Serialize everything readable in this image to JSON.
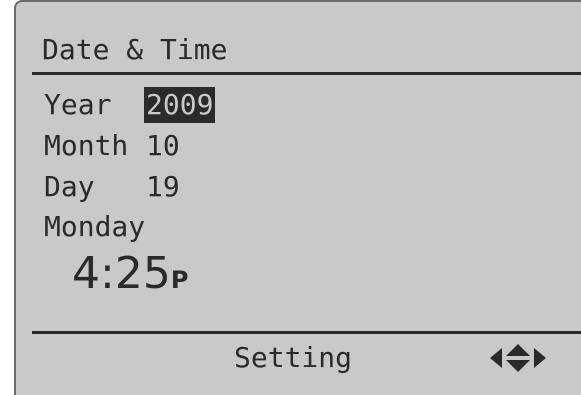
{
  "screen": {
    "title": "Date & Time",
    "fields": {
      "year": {
        "label": "Year",
        "value": "2009"
      },
      "month": {
        "label": "Month",
        "value": "10"
      },
      "day": {
        "label": "Day",
        "value": "19"
      }
    },
    "weekday": "Monday",
    "time": {
      "value": "4:25",
      "ampm": "P"
    },
    "softkey_label": "Setting",
    "nav_icon": "left-up-down-right-arrows-icon",
    "colors": {
      "lcd_background": "#c9c9c9",
      "lcd_foreground": "#2a2a2a"
    }
  }
}
